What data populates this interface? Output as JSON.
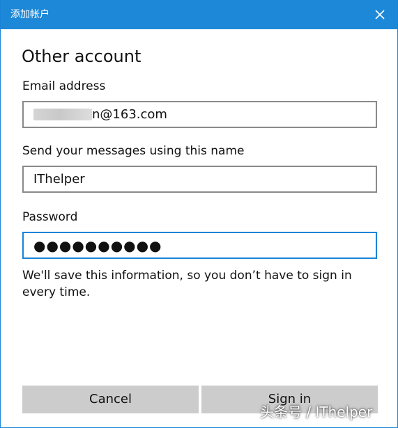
{
  "window": {
    "title": "添加帐户"
  },
  "form": {
    "heading": "Other account",
    "email": {
      "label": "Email address",
      "visible_value_suffix": "n@163.com"
    },
    "display_name": {
      "label": "Send your messages using this name",
      "value": "IThelper"
    },
    "password": {
      "label": "Password",
      "masked_value": "●●●●●●●●●●"
    },
    "info_text": "We'll save this information, so you don’t have to sign in every time."
  },
  "buttons": {
    "cancel_label": "Cancel",
    "sign_in_label": "Sign in"
  },
  "watermark": {
    "text": "头条号 / IThelper"
  },
  "icons": {
    "close": "close-icon"
  },
  "colors": {
    "titlebar": "#1e88d8",
    "border": "#1883d7",
    "button_background": "#cccccc",
    "field_border": "#8a8a8a"
  }
}
